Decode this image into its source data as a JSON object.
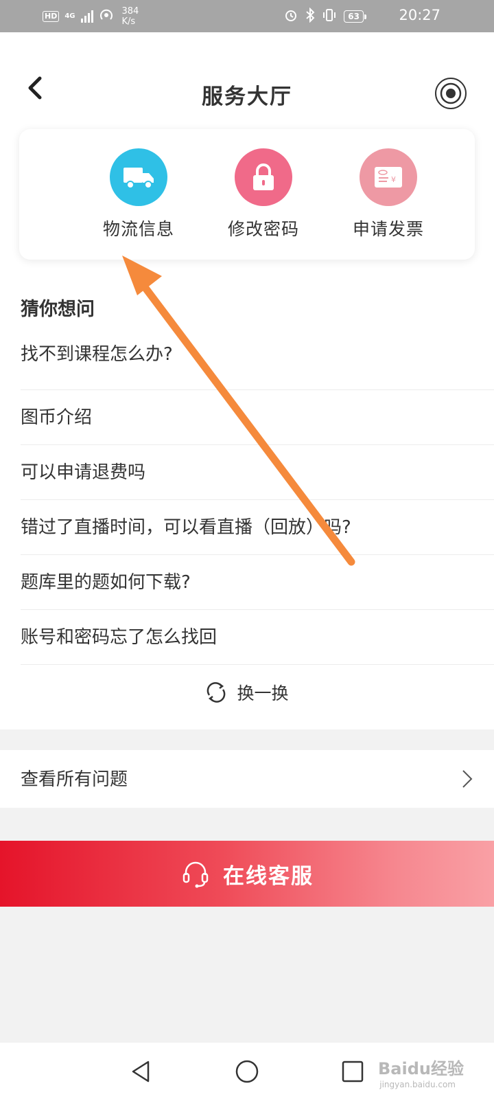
{
  "status_bar": {
    "hd": "HD",
    "network": "4G",
    "speed_value": "384",
    "speed_unit": "K/s",
    "battery": "63",
    "time": "20:27"
  },
  "header": {
    "title": "服务大厅",
    "back_icon": "chevron-left-icon",
    "right_icon": "target-icon"
  },
  "services": [
    {
      "label": "物流信息",
      "icon": "truck-icon",
      "color": "#2fc0e6"
    },
    {
      "label": "修改密码",
      "icon": "lock-icon",
      "color": "#f06a89"
    },
    {
      "label": "申请发票",
      "icon": "invoice-icon",
      "color": "#ee99a4"
    }
  ],
  "faq": {
    "title": "猜你想问",
    "items": [
      "找不到课程怎么办?",
      "图币介绍",
      "可以申请退费吗",
      "错过了直播时间，可以看直播（回放）吗?",
      "题库里的题如何下载?",
      "账号和密码忘了怎么找回"
    ],
    "refresh_label": "换一换"
  },
  "all_questions": {
    "label": "查看所有问题"
  },
  "online_service": {
    "label": "在线客服",
    "icon": "headset-icon"
  },
  "watermark": {
    "brand": "Baidu经验",
    "sub": "jingyan.baidu.com"
  },
  "colors": {
    "accent_red": "#e5142a",
    "annotation_arrow": "#f58a3c"
  }
}
